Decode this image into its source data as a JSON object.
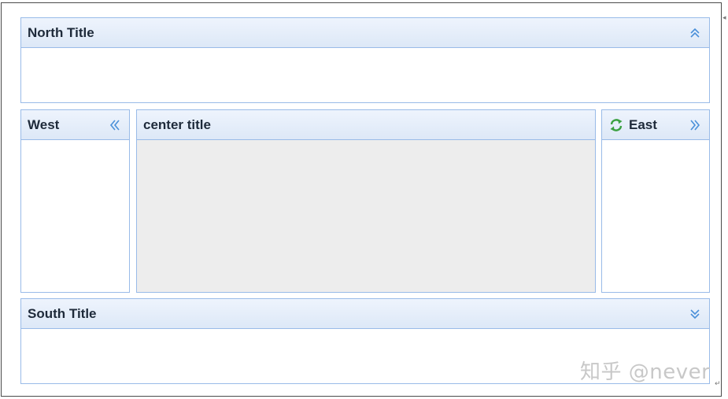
{
  "north": {
    "title": "North Title",
    "tool_icon": "double-chevron-up-icon"
  },
  "west": {
    "title": "West",
    "tool_icon": "double-chevron-left-icon"
  },
  "center": {
    "title": "center title"
  },
  "east": {
    "title": "East",
    "title_icon": "refresh-icon",
    "tool_icon": "double-chevron-right-icon"
  },
  "south": {
    "title": "South Title",
    "tool_icon": "double-chevron-down-icon"
  },
  "watermark": {
    "text": "知乎 @never"
  },
  "colors": {
    "panel_border": "#99bbe8",
    "header_top": "#eef4fd",
    "header_bottom": "#dde8f7",
    "tool_icon": "#4a90d9",
    "center_body": "#ededed",
    "refresh_icon": "#3aa040"
  }
}
